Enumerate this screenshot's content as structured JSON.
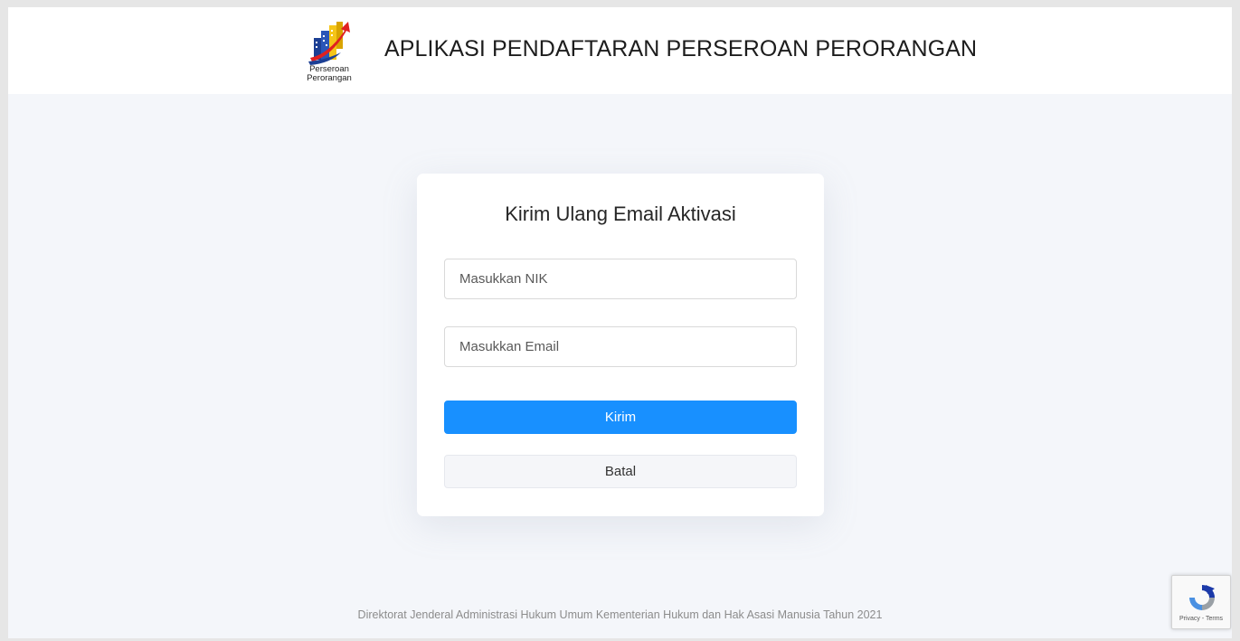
{
  "header": {
    "logo_line1": "Perseroan",
    "logo_line2": "Perorangan",
    "title": "APLIKASI PENDAFTARAN PERSEROAN PERORANGAN"
  },
  "form": {
    "title": "Kirim Ulang Email Aktivasi",
    "nik_placeholder": "Masukkan NIK",
    "nik_value": "",
    "email_placeholder": "Masukkan Email",
    "email_value": "",
    "submit_label": "Kirim",
    "cancel_label": "Batal"
  },
  "footer": {
    "text": "Direktorat Jenderal Administrasi Hukum Umum Kementerian Hukum dan Hak Asasi Manusia Tahun 2021"
  },
  "recaptcha": {
    "links": "Privacy - Terms"
  },
  "colors": {
    "primary": "#1890ff",
    "background": "#f4f6fa",
    "logo_red": "#e02020",
    "logo_blue": "#1c3f94",
    "logo_yellow": "#f5c518"
  }
}
